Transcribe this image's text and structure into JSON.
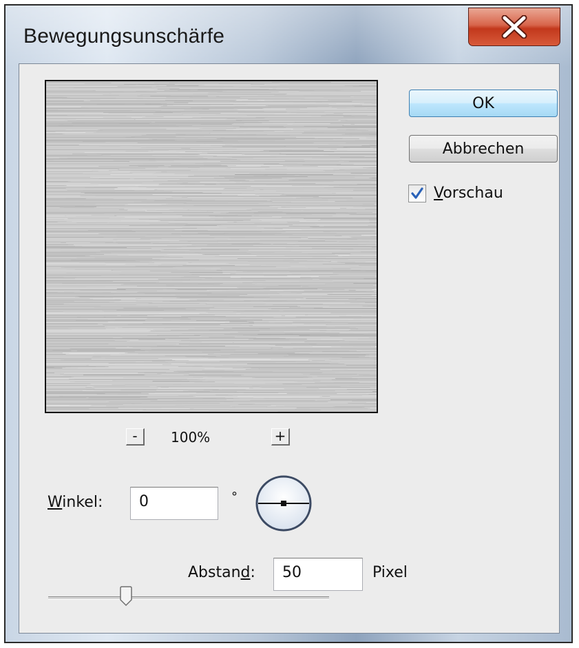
{
  "window": {
    "title": "Bewegungsunschärfe"
  },
  "buttons": {
    "ok": "OK",
    "cancel": "Abbrechen"
  },
  "preview_option": {
    "label_accel": "V",
    "label_rest": "orschau",
    "checked": true
  },
  "zoom": {
    "minus": "-",
    "level": "100%",
    "plus": "+"
  },
  "angle": {
    "label_accel": "W",
    "label_rest": "inkel:",
    "value": "0",
    "unit": "°"
  },
  "distance": {
    "label_pre": "Abstan",
    "label_accel": "d",
    "label_post": ":",
    "value": "50",
    "unit": "Pixel"
  },
  "slider": {
    "level_fraction": 0.27
  },
  "colors": {
    "ok_border": "#3c7fb1",
    "close_red": "#c2381c",
    "check_blue": "#2a62b8"
  },
  "icons": {
    "close": "close-icon",
    "check": "checkmark-icon",
    "dial": "angle-dial-icon"
  }
}
